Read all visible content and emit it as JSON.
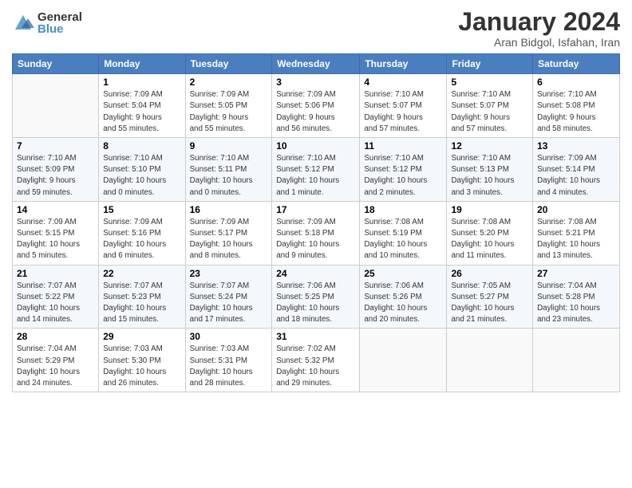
{
  "logo": {
    "general": "General",
    "blue": "Blue"
  },
  "title": "January 2024",
  "subtitle": "Aran Bidgol, Isfahan, Iran",
  "weekdays": [
    "Sunday",
    "Monday",
    "Tuesday",
    "Wednesday",
    "Thursday",
    "Friday",
    "Saturday"
  ],
  "weeks": [
    [
      {
        "num": "",
        "info": ""
      },
      {
        "num": "1",
        "info": "Sunrise: 7:09 AM\nSunset: 5:04 PM\nDaylight: 9 hours\nand 55 minutes."
      },
      {
        "num": "2",
        "info": "Sunrise: 7:09 AM\nSunset: 5:05 PM\nDaylight: 9 hours\nand 55 minutes."
      },
      {
        "num": "3",
        "info": "Sunrise: 7:09 AM\nSunset: 5:06 PM\nDaylight: 9 hours\nand 56 minutes."
      },
      {
        "num": "4",
        "info": "Sunrise: 7:10 AM\nSunset: 5:07 PM\nDaylight: 9 hours\nand 57 minutes."
      },
      {
        "num": "5",
        "info": "Sunrise: 7:10 AM\nSunset: 5:07 PM\nDaylight: 9 hours\nand 57 minutes."
      },
      {
        "num": "6",
        "info": "Sunrise: 7:10 AM\nSunset: 5:08 PM\nDaylight: 9 hours\nand 58 minutes."
      }
    ],
    [
      {
        "num": "7",
        "info": "Sunrise: 7:10 AM\nSunset: 5:09 PM\nDaylight: 9 hours\nand 59 minutes."
      },
      {
        "num": "8",
        "info": "Sunrise: 7:10 AM\nSunset: 5:10 PM\nDaylight: 10 hours\nand 0 minutes."
      },
      {
        "num": "9",
        "info": "Sunrise: 7:10 AM\nSunset: 5:11 PM\nDaylight: 10 hours\nand 0 minutes."
      },
      {
        "num": "10",
        "info": "Sunrise: 7:10 AM\nSunset: 5:12 PM\nDaylight: 10 hours\nand 1 minute."
      },
      {
        "num": "11",
        "info": "Sunrise: 7:10 AM\nSunset: 5:12 PM\nDaylight: 10 hours\nand 2 minutes."
      },
      {
        "num": "12",
        "info": "Sunrise: 7:10 AM\nSunset: 5:13 PM\nDaylight: 10 hours\nand 3 minutes."
      },
      {
        "num": "13",
        "info": "Sunrise: 7:09 AM\nSunset: 5:14 PM\nDaylight: 10 hours\nand 4 minutes."
      }
    ],
    [
      {
        "num": "14",
        "info": "Sunrise: 7:09 AM\nSunset: 5:15 PM\nDaylight: 10 hours\nand 5 minutes."
      },
      {
        "num": "15",
        "info": "Sunrise: 7:09 AM\nSunset: 5:16 PM\nDaylight: 10 hours\nand 6 minutes."
      },
      {
        "num": "16",
        "info": "Sunrise: 7:09 AM\nSunset: 5:17 PM\nDaylight: 10 hours\nand 8 minutes."
      },
      {
        "num": "17",
        "info": "Sunrise: 7:09 AM\nSunset: 5:18 PM\nDaylight: 10 hours\nand 9 minutes."
      },
      {
        "num": "18",
        "info": "Sunrise: 7:08 AM\nSunset: 5:19 PM\nDaylight: 10 hours\nand 10 minutes."
      },
      {
        "num": "19",
        "info": "Sunrise: 7:08 AM\nSunset: 5:20 PM\nDaylight: 10 hours\nand 11 minutes."
      },
      {
        "num": "20",
        "info": "Sunrise: 7:08 AM\nSunset: 5:21 PM\nDaylight: 10 hours\nand 13 minutes."
      }
    ],
    [
      {
        "num": "21",
        "info": "Sunrise: 7:07 AM\nSunset: 5:22 PM\nDaylight: 10 hours\nand 14 minutes."
      },
      {
        "num": "22",
        "info": "Sunrise: 7:07 AM\nSunset: 5:23 PM\nDaylight: 10 hours\nand 15 minutes."
      },
      {
        "num": "23",
        "info": "Sunrise: 7:07 AM\nSunset: 5:24 PM\nDaylight: 10 hours\nand 17 minutes."
      },
      {
        "num": "24",
        "info": "Sunrise: 7:06 AM\nSunset: 5:25 PM\nDaylight: 10 hours\nand 18 minutes."
      },
      {
        "num": "25",
        "info": "Sunrise: 7:06 AM\nSunset: 5:26 PM\nDaylight: 10 hours\nand 20 minutes."
      },
      {
        "num": "26",
        "info": "Sunrise: 7:05 AM\nSunset: 5:27 PM\nDaylight: 10 hours\nand 21 minutes."
      },
      {
        "num": "27",
        "info": "Sunrise: 7:04 AM\nSunset: 5:28 PM\nDaylight: 10 hours\nand 23 minutes."
      }
    ],
    [
      {
        "num": "28",
        "info": "Sunrise: 7:04 AM\nSunset: 5:29 PM\nDaylight: 10 hours\nand 24 minutes."
      },
      {
        "num": "29",
        "info": "Sunrise: 7:03 AM\nSunset: 5:30 PM\nDaylight: 10 hours\nand 26 minutes."
      },
      {
        "num": "30",
        "info": "Sunrise: 7:03 AM\nSunset: 5:31 PM\nDaylight: 10 hours\nand 28 minutes."
      },
      {
        "num": "31",
        "info": "Sunrise: 7:02 AM\nSunset: 5:32 PM\nDaylight: 10 hours\nand 29 minutes."
      },
      {
        "num": "",
        "info": ""
      },
      {
        "num": "",
        "info": ""
      },
      {
        "num": "",
        "info": ""
      }
    ]
  ]
}
